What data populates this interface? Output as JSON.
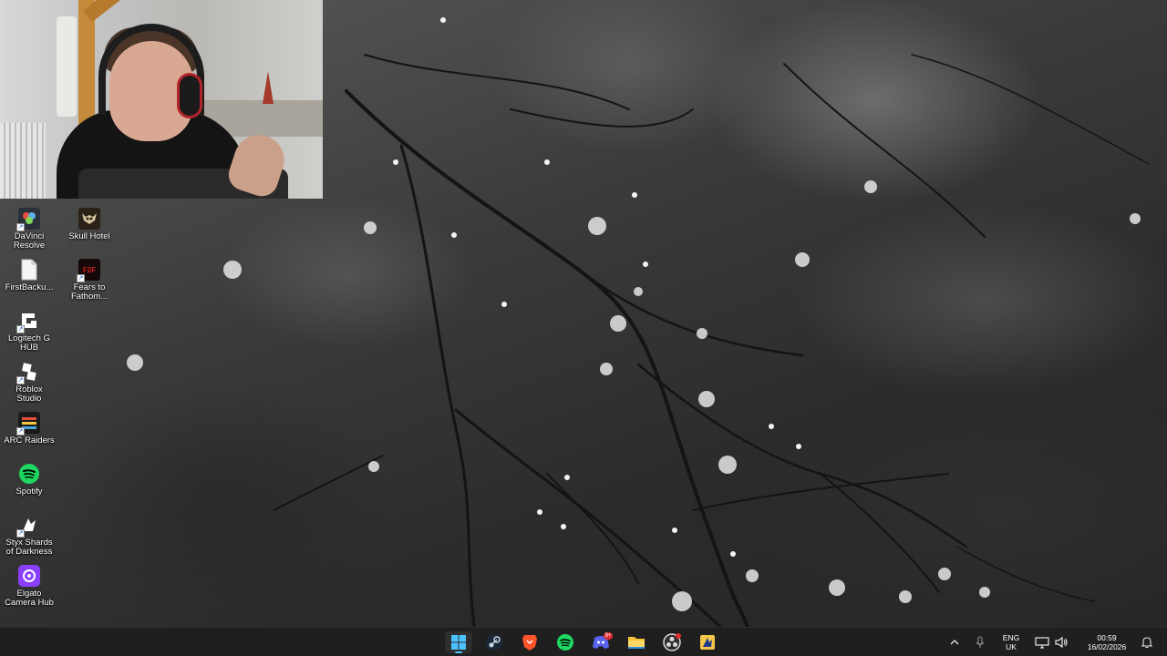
{
  "desktop": {
    "icons": [
      {
        "label": "DaVinci\nResolve",
        "icon": "davinci-resolve-icon"
      },
      {
        "label": "Skull Hotel",
        "icon": "skull-hotel-icon"
      },
      {
        "label": "FirstBacku...",
        "icon": "file-icon"
      },
      {
        "label": "Fears to\nFathom...",
        "icon": "fears-to-fathom-icon"
      },
      {
        "label": "Logitech G\nHUB",
        "icon": "logitech-ghub-icon"
      },
      {
        "label": "Roblox\nStudio",
        "icon": "roblox-studio-icon"
      },
      {
        "label": "ARC Raiders",
        "icon": "arc-raiders-icon"
      },
      {
        "label": "Spotify",
        "icon": "spotify-icon"
      },
      {
        "label": "Styx Shards\nof Darkness",
        "icon": "styx-icon"
      },
      {
        "label": "Elgato\nCamera Hub",
        "icon": "elgato-camera-hub-icon"
      }
    ],
    "fears_badge": "F2F"
  },
  "taskbar": {
    "apps": [
      {
        "name": "start",
        "icon": "windows-start-icon",
        "active": true
      },
      {
        "name": "steam",
        "icon": "steam-icon"
      },
      {
        "name": "brave",
        "icon": "brave-browser-icon"
      },
      {
        "name": "spotify",
        "icon": "spotify-icon"
      },
      {
        "name": "discord",
        "icon": "discord-icon",
        "badge": "9+"
      },
      {
        "name": "file-explorer",
        "icon": "folder-icon"
      },
      {
        "name": "obs",
        "icon": "obs-icon"
      },
      {
        "name": "app",
        "icon": "app-icon"
      }
    ],
    "tray": {
      "language_line1": "ENG",
      "language_line2": "UK",
      "time": "00:59",
      "date": "16/02/2026"
    }
  },
  "colors": {
    "taskbar_bg": "#1f1f1f",
    "accent": "#4cc2ff",
    "spotify_green": "#1ed760",
    "brave_orange": "#fb542b",
    "discord_blurple": "#5865f2",
    "elgato_purple": "#8a3ffc"
  }
}
